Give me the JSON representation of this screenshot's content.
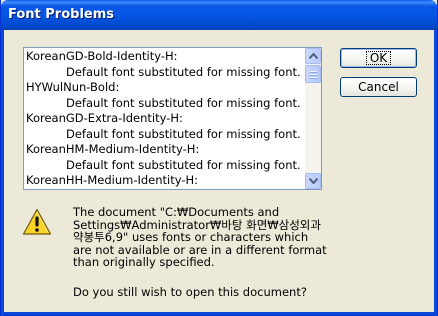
{
  "window": {
    "title": "Font Problems"
  },
  "font_list": [
    {
      "text": "KoreanGD-Bold-Identity-H:",
      "sub": false
    },
    {
      "text": "Default font substituted for missing font.",
      "sub": true
    },
    {
      "text": "HYWulNun-Bold:",
      "sub": false
    },
    {
      "text": "Default font substituted for missing font.",
      "sub": true
    },
    {
      "text": "KoreanGD-Extra-Identity-H:",
      "sub": false
    },
    {
      "text": "Default font substituted for missing font.",
      "sub": true
    },
    {
      "text": "KoreanHM-Medium-Identity-H:",
      "sub": false
    },
    {
      "text": "Default font substituted for missing font.",
      "sub": true
    },
    {
      "text": "KoreanHH-Medium-Identity-H:",
      "sub": false
    },
    {
      "text": "Default font substituted for missing font.",
      "sub": true
    }
  ],
  "buttons": {
    "ok": "OK",
    "cancel": "Cancel"
  },
  "message": {
    "lines": [
      "The document \"C:₩Documents and",
      "Settings₩Administrator₩바탕 화면₩삼성외과",
      "약봉투6,9\" uses fonts or characters which",
      "are not available or are in a different format",
      "than originally specified."
    ],
    "question": "Do you still wish to open this document?"
  },
  "icons": {
    "warning": "warning-icon",
    "scroll_up": "arrow-up-icon",
    "scroll_down": "arrow-down-icon"
  }
}
